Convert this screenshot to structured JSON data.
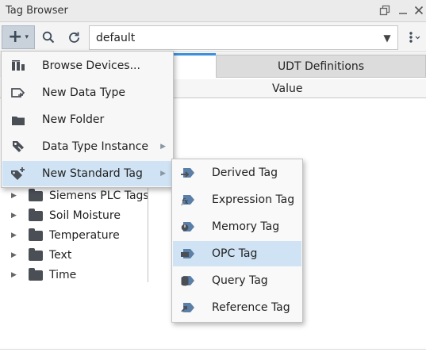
{
  "window": {
    "title": "Tag Browser"
  },
  "toolbar": {
    "provider_value": "default"
  },
  "tabs": {
    "udt_definitions": "UDT Definitions"
  },
  "columns": {
    "value": "Value"
  },
  "tree": {
    "items": [
      {
        "label": "Siemens PLC Tags"
      },
      {
        "label": "Soil Moisture"
      },
      {
        "label": "Temperature"
      },
      {
        "label": "Text"
      },
      {
        "label": "Time"
      }
    ]
  },
  "add_menu": {
    "items": [
      {
        "label": "Browse Devices...",
        "icon": "browse-devices-icon"
      },
      {
        "label": "New Data Type",
        "icon": "data-type-icon"
      },
      {
        "label": "New Folder",
        "icon": "folder-icon"
      },
      {
        "label": "Data Type Instance",
        "icon": "data-type-instance-icon"
      },
      {
        "label": "New Standard Tag",
        "icon": "standard-tag-icon"
      }
    ]
  },
  "standard_tag_menu": {
    "items": [
      {
        "label": "Derived Tag",
        "icon": "derived-tag-icon"
      },
      {
        "label": "Expression Tag",
        "icon": "expression-tag-icon"
      },
      {
        "label": "Memory Tag",
        "icon": "memory-tag-icon"
      },
      {
        "label": "OPC Tag",
        "icon": "opc-tag-icon"
      },
      {
        "label": "Query Tag",
        "icon": "query-tag-icon"
      },
      {
        "label": "Reference Tag",
        "icon": "reference-tag-icon"
      }
    ]
  },
  "colors": {
    "menu_highlight": "#cfe3f4",
    "active_tab_accent": "#3d8fdc",
    "icon_dark": "#4a4e55",
    "tag_icon_blue": "#5b7fa6"
  }
}
